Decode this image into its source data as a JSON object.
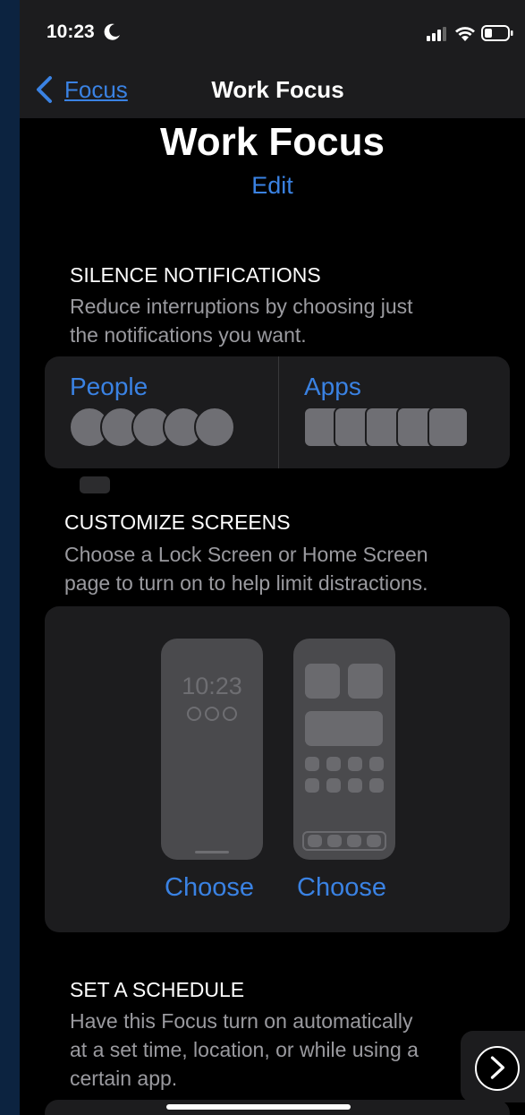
{
  "status": {
    "time": "10:23"
  },
  "nav": {
    "back_label": "Focus",
    "title": "Work Focus"
  },
  "header": {
    "title": "Work Focus",
    "edit_label": "Edit"
  },
  "silence": {
    "title": "SILENCE NOTIFICATIONS",
    "desc_line1": "Reduce interruptions by choosing just",
    "desc_line2": "the notifications you want.",
    "people_label": "People",
    "apps_label": "Apps"
  },
  "customize": {
    "title": "CUSTOMIZE SCREENS",
    "desc_line1": "Choose a Lock Screen or Home Screen",
    "desc_line2": "page to turn on to help limit distractions.",
    "lock_preview_time": "10:23",
    "choose_lock_label": "Choose",
    "choose_home_label": "Choose"
  },
  "schedule": {
    "title": "SET A SCHEDULE",
    "desc_line1": "Have this Focus turn on automatically",
    "desc_line2": "at a set time, location, or while using a",
    "desc_line3": "certain app."
  },
  "colors": {
    "accent": "#3a82e3",
    "card": "#1c1c1e",
    "background": "#000000"
  },
  "icons": [
    "moon-icon",
    "signal-icon",
    "wifi-icon",
    "battery-icon",
    "chevron-left-icon",
    "chevron-right-icon"
  ]
}
